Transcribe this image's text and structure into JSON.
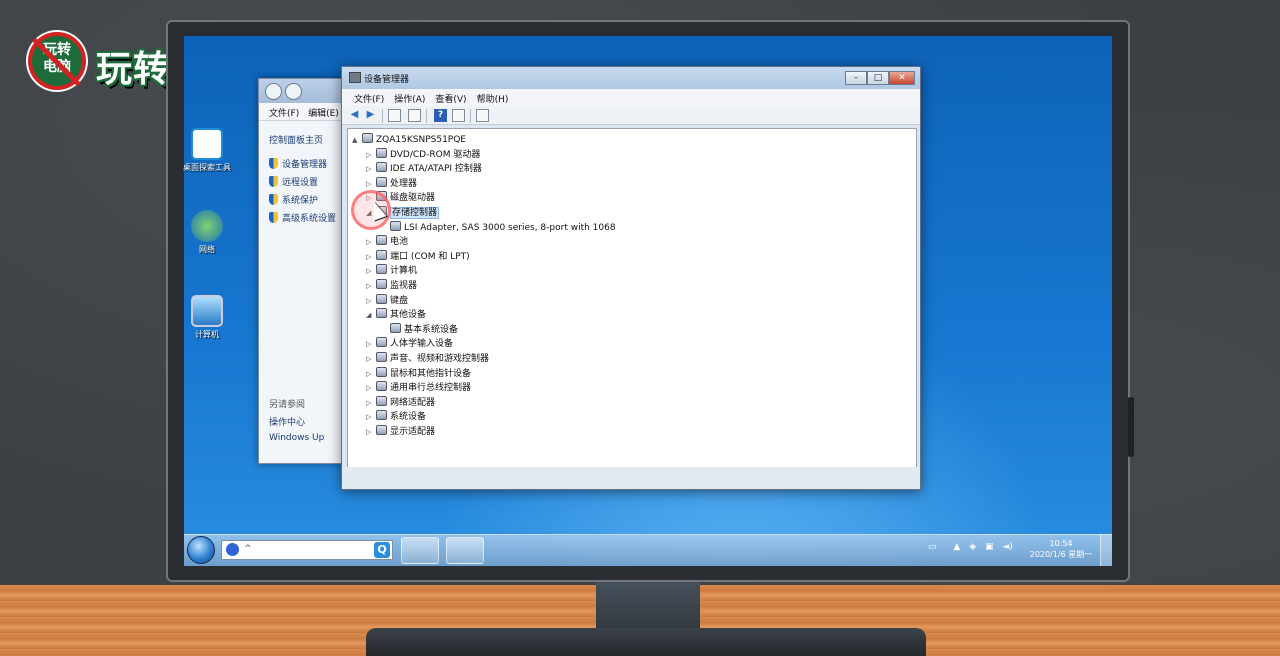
{
  "branding": {
    "badge_top": "玩转",
    "badge_bottom": "电脑",
    "title": "玩转电脑"
  },
  "desktop": {
    "icons": [
      {
        "label": "桌面探索工具",
        "icon": "magnifier-app-icon"
      },
      {
        "label": "网络",
        "icon": "globe-network-icon"
      },
      {
        "label": "计算机",
        "icon": "computer-icon"
      }
    ]
  },
  "system_window": {
    "menu": [
      "文件(F)",
      "编辑(E)"
    ],
    "home_link": "控制面板主页",
    "links": [
      "设备管理器",
      "远程设置",
      "系统保护",
      "高级系统设置"
    ],
    "see_also_title": "另请参阅",
    "see_also": [
      "操作中心",
      "Windows Up"
    ]
  },
  "device_manager": {
    "title": "设备管理器",
    "menu": [
      "文件(F)",
      "操作(A)",
      "查看(V)",
      "帮助(H)"
    ],
    "tree": [
      {
        "label": "ZQA15KSNPS51PQE",
        "level": 0,
        "arrow": "▲"
      },
      {
        "label": "DVD/CD-ROM 驱动器",
        "level": 1,
        "arrow": "▷"
      },
      {
        "label": "IDE ATA/ATAPI 控制器",
        "level": 1,
        "arrow": "▷"
      },
      {
        "label": "处理器",
        "level": 1,
        "arrow": "▷"
      },
      {
        "label": "磁盘驱动器",
        "level": 1,
        "arrow": "▷"
      },
      {
        "label": "存储控制器",
        "level": 1,
        "arrow": "◢",
        "selected": true
      },
      {
        "label": "LSI Adapter, SAS 3000 series, 8-port with 1068",
        "level": 2,
        "arrow": ""
      },
      {
        "label": "电池",
        "level": 1,
        "arrow": "▷"
      },
      {
        "label": "端口 (COM 和 LPT)",
        "level": 1,
        "arrow": "▷"
      },
      {
        "label": "计算机",
        "level": 1,
        "arrow": "▷"
      },
      {
        "label": "监视器",
        "level": 1,
        "arrow": "▷"
      },
      {
        "label": "键盘",
        "level": 1,
        "arrow": "▷"
      },
      {
        "label": "其他设备",
        "level": 1,
        "arrow": "◢"
      },
      {
        "label": "基本系统设备",
        "level": 2,
        "arrow": ""
      },
      {
        "label": "人体学输入设备",
        "level": 1,
        "arrow": "▷"
      },
      {
        "label": "声音、视频和游戏控制器",
        "level": 1,
        "arrow": "▷"
      },
      {
        "label": "鼠标和其他指针设备",
        "level": 1,
        "arrow": "▷"
      },
      {
        "label": "通用串行总线控制器",
        "level": 1,
        "arrow": "▷"
      },
      {
        "label": "网络适配器",
        "level": 1,
        "arrow": "▷"
      },
      {
        "label": "系统设备",
        "level": 1,
        "arrow": "▷"
      },
      {
        "label": "显示适配器",
        "level": 1,
        "arrow": "▷"
      }
    ]
  },
  "taskbar": {
    "search_placeholder": "^",
    "clock_time": "10:54",
    "clock_date": "2020/1/6 星期一"
  },
  "colors": {
    "desktop_blue": "#1776d0",
    "selection": "#cfe3fa",
    "close_red": "#c7452f"
  }
}
